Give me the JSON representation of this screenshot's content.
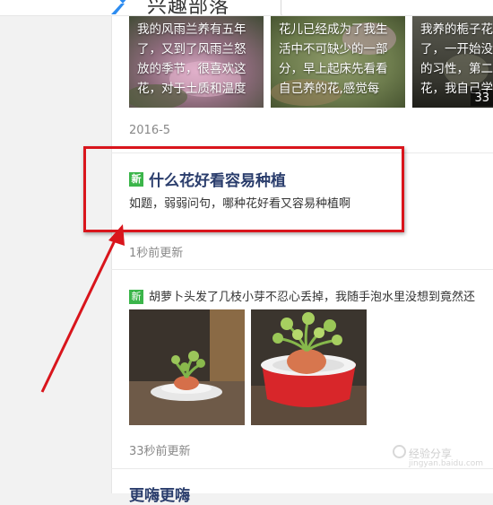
{
  "header": {
    "site_name": "兴趣部落",
    "logo_icon": "tribe-logo-icon"
  },
  "thumbnails": [
    {
      "text_lines": [
        "我的风雨兰养有五年",
        "了，又到了风雨兰怒",
        "放的季节，很喜欢这",
        "花，对于土质和温度"
      ]
    },
    {
      "text_lines": [
        "",
        "花儿已经成为了我生",
        "活中不可缺少的一部",
        "分，早上起床先看看",
        "自己养的花,感觉每"
      ]
    },
    {
      "text_lines": [
        "我养的栀子花",
        "了，一开始没",
        "的习性，第二",
        "花，我自己学"
      ],
      "count": "33"
    }
  ],
  "thumbs_time": "2016-5",
  "post1": {
    "badge": "新",
    "title": "什么花好看容易种植",
    "desc": "如题，弱弱问句，哪种花好看又容易种植啊",
    "time": "1秒前更新"
  },
  "post2": {
    "badge": "新",
    "title": "胡萝卜头发了几枝小芽不忍心丢掉，我随手泡水里没想到竟然还",
    "time": "33秒前更新"
  },
  "bottom_title": "更嗨更嗨",
  "watermark": {
    "text": "经验分享",
    "url": "jingyan.baidu.com"
  },
  "colors": {
    "highlight": "#d9151c",
    "badge": "#3bb54a",
    "title": "#2a3d6c"
  }
}
